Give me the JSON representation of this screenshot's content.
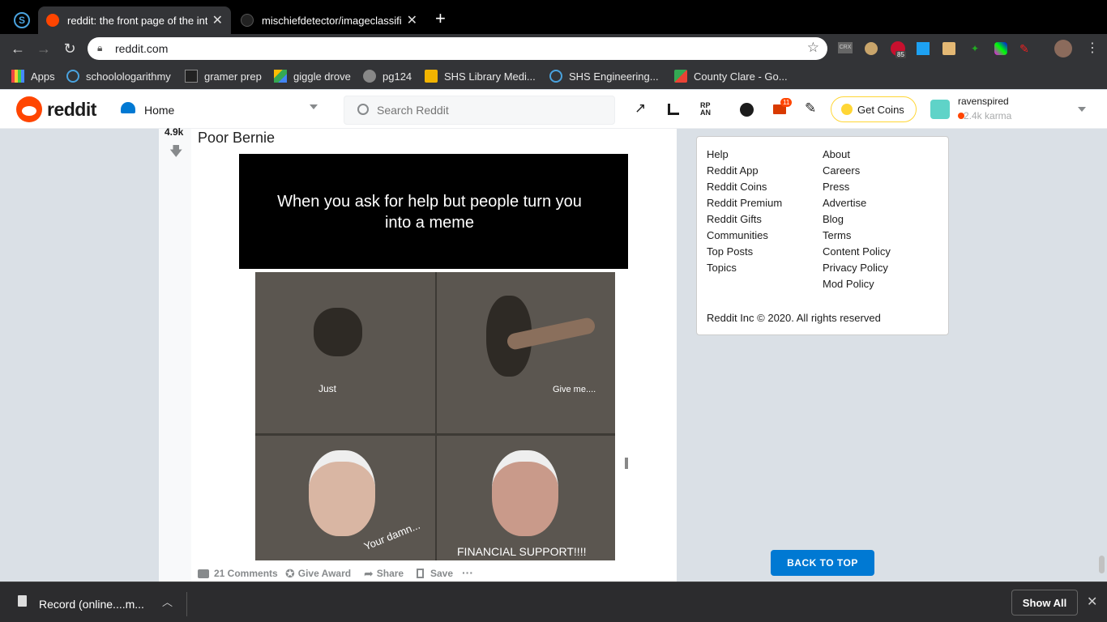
{
  "browser": {
    "tabs": [
      {
        "title": "reddit: the front page of the int",
        "active": true
      },
      {
        "title": "mischiefdetector/imageclassifi",
        "active": false
      }
    ],
    "new_tab": "+",
    "url": "reddit.com",
    "bookmarks": [
      "Apps",
      "schoolologarithmy",
      "gramer prep",
      "giggle drove",
      "pg124",
      "SHS Library Medi...",
      "SHS Engineering...",
      "County Clare - Go..."
    ],
    "ext_badge": "85"
  },
  "reddit": {
    "logo": "reddit",
    "feed_selector": "Home",
    "search_placeholder": "Search Reddit",
    "notif_count": "11",
    "get_coins": "Get Coins",
    "username": "ravenspired",
    "karma": "2.4k karma"
  },
  "post": {
    "votes": "4.9k",
    "title": "Poor Bernie",
    "meme_caption": "When you ask for help but people turn you into a meme",
    "panel_texts": [
      "Just",
      "Give me....",
      "Your damn...",
      "FINANCIAL SUPPORT!!!!"
    ],
    "actions": {
      "comments": "21 Comments",
      "award": "Give Award",
      "share": "Share",
      "save": "Save",
      "more": "···"
    }
  },
  "sidebar": {
    "col1": [
      "Help",
      "Reddit App",
      "Reddit Coins",
      "Reddit Premium",
      "Reddit Gifts",
      "Communities",
      "Top Posts",
      "Topics"
    ],
    "col2": [
      "About",
      "Careers",
      "Press",
      "Advertise",
      "Blog",
      "Terms",
      "Content Policy",
      "Privacy Policy",
      "Mod Policy"
    ],
    "copyright": "Reddit Inc © 2020. All rights reserved",
    "back_to_top": "BACK TO TOP"
  },
  "downloads": {
    "item": "Record (online....m...",
    "show_all": "Show All"
  },
  "colors": {
    "reddit_orange": "#ff4500",
    "reddit_blue": "#0079d3",
    "coin_gold": "#ffd635"
  }
}
